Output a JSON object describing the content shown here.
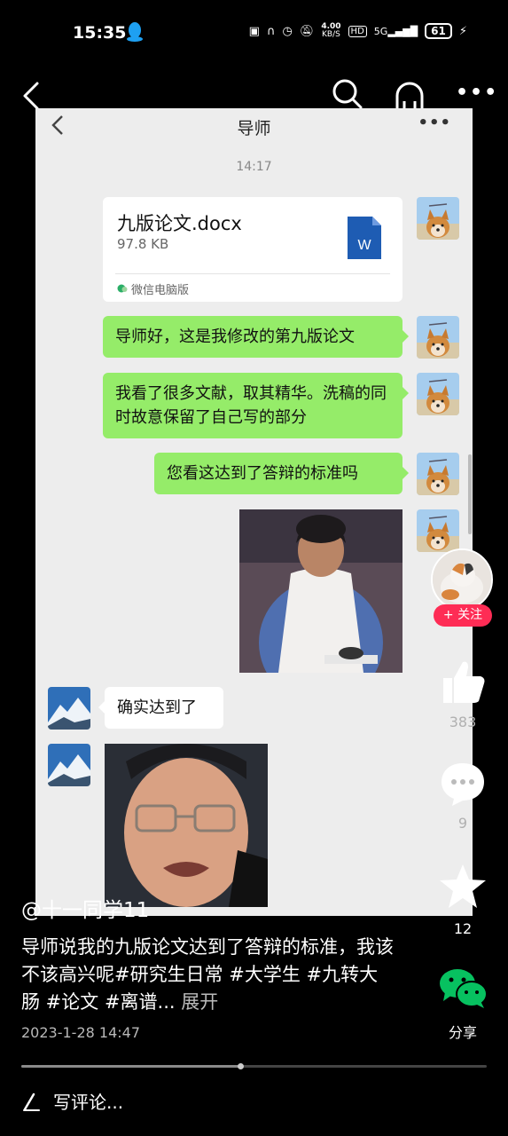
{
  "status_bar": {
    "time": "15:35",
    "net_speed_value": "4.00",
    "net_speed_unit": "KB/S",
    "hd": "HD",
    "signal": "5G",
    "battery": "61"
  },
  "chat": {
    "title": "导师",
    "timestamp": "14:17",
    "file": {
      "name": "九版论文.docx",
      "size": "97.8 KB",
      "source": "微信电脑版",
      "icon_letter": "W"
    },
    "messages": [
      {
        "text": "导师好，这是我修改的第九版论文",
        "side": "right"
      },
      {
        "text": "我看了很多文献，取其精华。洗稿的同时故意保留了自己写的部分",
        "side": "right"
      },
      {
        "text": "您看这达到了答辩的标准吗",
        "side": "right"
      },
      {
        "text": "确实达到了",
        "side": "left"
      }
    ]
  },
  "rail": {
    "follow_label": "+ 关注",
    "like_count": "383",
    "comment_count": "9",
    "favorite_count": "12",
    "share_label": "分享"
  },
  "post": {
    "author": "@十一同学11",
    "caption": "导师说我的九版论文达到了答辩的标准，我该不该高兴呢#研究生日常 #大学生 #九转大肠 #论文 #离谱...",
    "expand": "展开",
    "date": "2023-1-28 14:47",
    "comment_placeholder": "写评论...",
    "progress": 0.47
  },
  "colors": {
    "accent_follow": "#fe2c55",
    "bubble_green": "#95ec69",
    "wechat_green": "#07c160"
  }
}
